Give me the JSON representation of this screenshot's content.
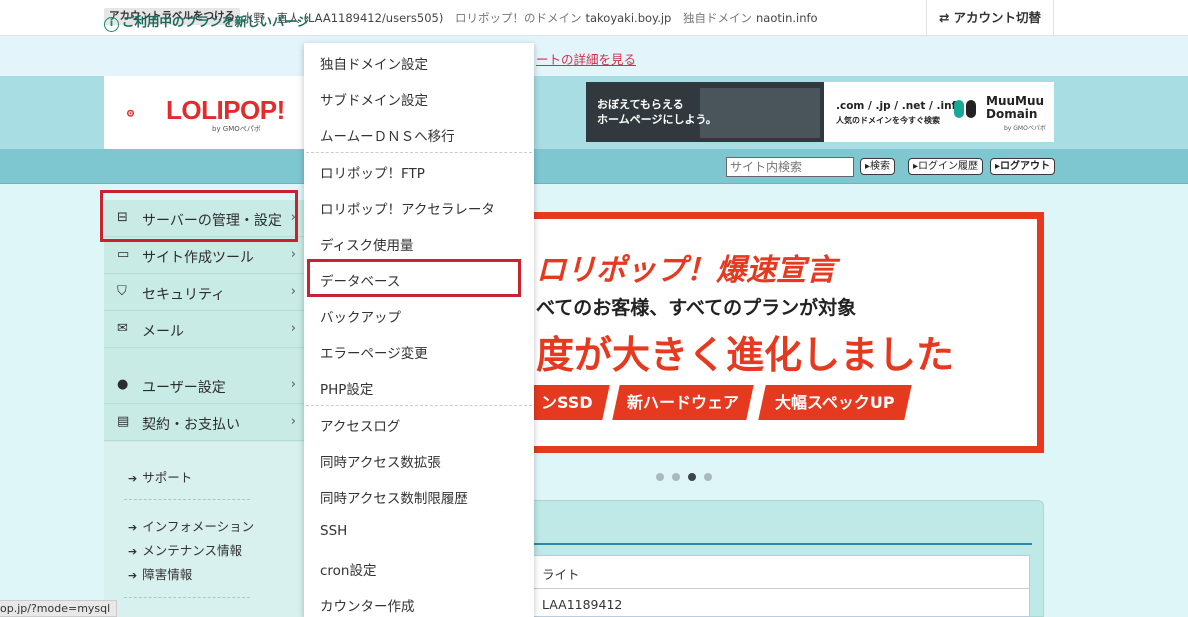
{
  "topbar": {
    "label_button": "アカウントラベルをつける",
    "owner_name": "水野　直人",
    "account_id": "(LAA1189412/users505)",
    "lolipop_domain_label": "ロリポップ！のドメイン",
    "lolipop_domain": "takoyaki.boy.jp",
    "custom_domain_label": "独自ドメイン",
    "custom_domain": "naotin.info",
    "switch_icon": "⇄",
    "switch_label": "アカウント切替"
  },
  "notice": {
    "icon": "i",
    "text": "ご利用中のプランを新しいバージ",
    "link": "ートの詳細を見る"
  },
  "header": {
    "logo_text": "LOLIPOP!",
    "logo_sub": "by GMOペパボ",
    "ad_left_line1": "おぼえてもらえる",
    "ad_left_line2": "ホームページにしよう。",
    "ad_right_line1": ".com / .jp / .net / .info",
    "ad_right_line2": "人気のドメインを今すぐ検索",
    "ad_brand_line1": "MuuMuu",
    "ad_brand_line2": "Domain",
    "ad_brand_sub": "by GMOペパボ"
  },
  "navstrip": {
    "search_placeholder": "サイト内検索",
    "search_button": "検索",
    "login_history_button": "ログイン履歴",
    "logout_button": "ログアウト"
  },
  "sidebar": {
    "items": [
      {
        "icon": "server-icon",
        "glyph": "⊟",
        "label": "サーバーの管理・設定"
      },
      {
        "icon": "laptop-icon",
        "glyph": "▭",
        "label": "サイト作成ツール"
      },
      {
        "icon": "shield-icon",
        "glyph": "⛉",
        "label": "セキュリティ"
      },
      {
        "icon": "mail-icon",
        "glyph": "✉",
        "label": "メール"
      },
      {
        "icon": "user-icon",
        "glyph": "●",
        "label": "ユーザー設定"
      },
      {
        "icon": "card-icon",
        "glyph": "▤",
        "label": "契約・お支払い"
      }
    ],
    "chevron": "›",
    "links": [
      {
        "label": "サポート"
      },
      {
        "label": "インフォメーション"
      },
      {
        "label": "メンテナンス情報"
      },
      {
        "label": "障害情報"
      }
    ],
    "link_arrow": "➔"
  },
  "dropdown": {
    "items": [
      "独自ドメイン設定",
      "サブドメイン設定",
      "ムームーＤＮＳへ移行",
      "ロリポップ！FTP",
      "ロリポップ！アクセラレータ",
      "ディスク使用量",
      "データベース",
      "バックアップ",
      "エラーページ変更",
      "PHP設定",
      "アクセスログ",
      "同時アクセス数拡張",
      "同時アクセス数制限履歴",
      "SSH",
      "cron設定",
      "カウンター作成"
    ]
  },
  "banner": {
    "title": "ロリポップ！爆速宣言",
    "subtitle": "べてのお客様、すべてのプランが対象",
    "headline": "度が大きく進化しました",
    "pills": [
      "ンSSD",
      "新ハードウェア",
      "大幅スペックUP"
    ],
    "active_slide": 3,
    "slide_count": 4
  },
  "panel": {
    "row1": "ライト",
    "row2": "LAA1189412"
  },
  "status_url": "op.jp/?mode=mysql",
  "colors": {
    "highlight": "#c8232e",
    "brand_red": "#e53a1f",
    "nav_teal": "#7ec7d1"
  }
}
